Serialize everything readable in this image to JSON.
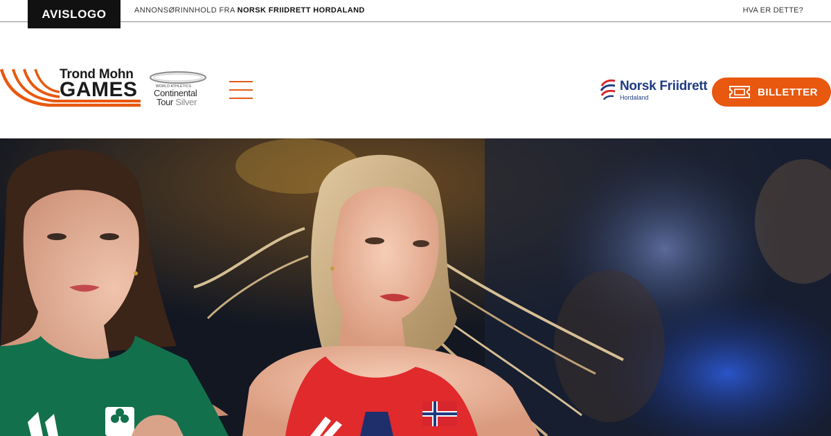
{
  "ad_strip": {
    "newspaper_logo": "AVISLOGO",
    "sponsored_prefix": "ANNONSØRINNHOLD FRA",
    "sponsor_name": "NORSK FRIIDRETT HORDALAND",
    "what_is_this": "HVA ER DETTE?"
  },
  "header": {
    "logo": {
      "line1": "Trond Mohn",
      "line2": "GAMES",
      "icon": "track-lanes-icon"
    },
    "badge": {
      "small": "WORLD ATHLETICS",
      "line1": "Continental",
      "line2_a": "Tour",
      "line2_b": "Silver"
    },
    "menu_icon": "hamburger-icon",
    "partner": {
      "name": "Norsk Friidrett",
      "sub": "Hordaland"
    },
    "tickets_button": {
      "label": "BILLETTER",
      "icon": "ticket-icon"
    }
  },
  "hero": {
    "image": "two female runners racing, one in green Irish kit and one in red Norwegian kit"
  },
  "colors": {
    "accent": "#e8580f",
    "partner_blue": "#1f3b82",
    "topbar_logo_bg": "#111111"
  }
}
